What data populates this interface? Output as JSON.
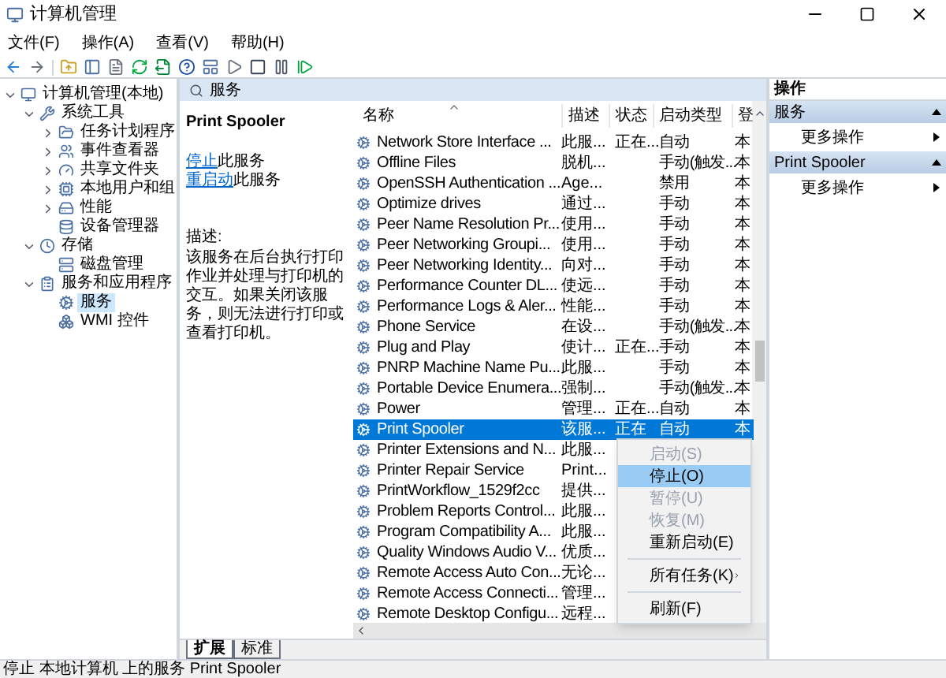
{
  "window": {
    "title": "计算机管理"
  },
  "menu": [
    "文件(F)",
    "操作(A)",
    "查看(V)",
    "帮助(H)"
  ],
  "tree": [
    {
      "label": "计算机管理(本地)",
      "selected": false,
      "expanded": true,
      "children": [
        {
          "label": "系统工具",
          "selected": false,
          "expanded": true,
          "children": [
            {
              "label": "任务计划程序",
              "selected": false,
              "expanded": false
            },
            {
              "label": "事件查看器",
              "selected": false,
              "expanded": false
            },
            {
              "label": "共享文件夹",
              "selected": false,
              "expanded": false
            },
            {
              "label": "本地用户和组",
              "selected": false,
              "expanded": false
            },
            {
              "label": "性能",
              "selected": false,
              "expanded": false
            },
            {
              "label": "设备管理器",
              "selected": false
            }
          ]
        },
        {
          "label": "存储",
          "selected": false,
          "expanded": true,
          "children": [
            {
              "label": "磁盘管理",
              "selected": false
            }
          ]
        },
        {
          "label": "服务和应用程序",
          "selected": false,
          "expanded": true,
          "children": [
            {
              "label": "服务",
              "selected": true
            },
            {
              "label": "WMI 控件",
              "selected": false
            }
          ]
        }
      ]
    }
  ],
  "pane_header": "服务",
  "detail": {
    "title": "Print Spooler",
    "actions": [
      {
        "link": "停止",
        "rest": "此服务"
      },
      {
        "link": "重启动",
        "rest": "此服务"
      }
    ],
    "description_label": "描述:",
    "description": "该服务在后台执行打印作业并处理与打印机的交互。如果关闭该服务，则无法进行打印或查看打印机。"
  },
  "table": {
    "columns": [
      "名称",
      "描述",
      "状态",
      "启动类型",
      "登"
    ],
    "rows": [
      {
        "name": "Network Store Interface ...",
        "desc": "此服...",
        "status": "正在...",
        "startup": "自动",
        "column_5": "本",
        "selected": false
      },
      {
        "name": "Offline Files",
        "desc": "脱机...",
        "startup": "手动(触发...",
        "column_5": "本",
        "selected": false
      },
      {
        "name": "OpenSSH Authentication ...",
        "desc": "Age...",
        "startup": "禁用",
        "column_5": "本",
        "selected": false
      },
      {
        "name": "Optimize drives",
        "desc": "通过...",
        "startup": "手动",
        "column_5": "本",
        "selected": false
      },
      {
        "name": "Peer Name Resolution Pr...",
        "desc": "使用...",
        "startup": "手动",
        "column_5": "本",
        "selected": false
      },
      {
        "name": "Peer Networking Groupi...",
        "desc": "使用...",
        "startup": "手动",
        "column_5": "本",
        "selected": false
      },
      {
        "name": "Peer Networking Identity...",
        "desc": "向对...",
        "startup": "手动",
        "column_5": "本",
        "selected": false
      },
      {
        "name": "Performance Counter DL...",
        "desc": "使远...",
        "startup": "手动",
        "column_5": "本",
        "selected": false
      },
      {
        "name": "Performance Logs & Aler...",
        "desc": "性能...",
        "startup": "手动",
        "column_5": "本",
        "selected": false
      },
      {
        "name": "Phone Service",
        "desc": "在设...",
        "startup": "手动(触发...",
        "column_5": "本",
        "selected": false
      },
      {
        "name": "Plug and Play",
        "desc": "使计...",
        "status": "正在...",
        "startup": "手动",
        "column_5": "本",
        "selected": false
      },
      {
        "name": "PNRP Machine Name Pu...",
        "desc": "此服...",
        "startup": "手动",
        "column_5": "本",
        "selected": false
      },
      {
        "name": "Portable Device Enumera...",
        "desc": "强制...",
        "startup": "手动(触发...",
        "column_5": "本",
        "selected": false
      },
      {
        "name": "Power",
        "desc": "管理...",
        "status": "正在...",
        "startup": "自动",
        "column_5": "本",
        "selected": false
      },
      {
        "name": "Print Spooler",
        "desc": "该服...",
        "status": "正在",
        "startup": "自动",
        "column_5": "本",
        "selected": true
      },
      {
        "name": "Printer Extensions and N...",
        "desc": "此服...",
        "selected": false
      },
      {
        "name": "Printer Repair Service",
        "desc": "Print...",
        "selected": false
      },
      {
        "name": "PrintWorkflow_1529f2cc",
        "desc": "提供...",
        "selected": false
      },
      {
        "name": "Problem Reports Control...",
        "desc": "此服...",
        "selected": false
      },
      {
        "name": "Program Compatibility A...",
        "desc": "此服...",
        "selected": false
      },
      {
        "name": "Quality Windows Audio V...",
        "desc": "优质...",
        "selected": false
      },
      {
        "name": "Remote Access Auto Con...",
        "desc": "无论...",
        "selected": false
      },
      {
        "name": "Remote Access Connecti...",
        "desc": "管理...",
        "selected": false
      },
      {
        "name": "Remote Desktop Configu...",
        "desc": "远程...",
        "selected": false
      }
    ]
  },
  "context_menu": [
    {
      "kind": "item",
      "label": "启动(S)",
      "disabled": true,
      "selected": false
    },
    {
      "kind": "item",
      "label": "停止(O)",
      "disabled": false,
      "selected": true
    },
    {
      "kind": "item",
      "label": "暂停(U)",
      "disabled": true,
      "selected": false
    },
    {
      "kind": "item",
      "label": "恢复(M)",
      "disabled": true,
      "selected": false
    },
    {
      "kind": "item",
      "label": "重新启动(E)",
      "disabled": false,
      "selected": false
    },
    {
      "kind": "separator"
    },
    {
      "kind": "submenu",
      "label": "所有任务(K)",
      "disabled": false,
      "selected": false
    },
    {
      "kind": "separator"
    },
    {
      "kind": "item",
      "label": "刷新(F)",
      "disabled": false,
      "selected": false
    }
  ],
  "bottom_tabs": [
    {
      "label": "扩展",
      "selected": true
    },
    {
      "label": "标准",
      "selected": false
    }
  ],
  "actions_pane": {
    "title": "操作",
    "sections": [
      {
        "title": "服务",
        "expanded": true,
        "items": [
          "更多操作"
        ]
      },
      {
        "title": "Print Spooler",
        "expanded": true,
        "items": [
          "更多操作"
        ]
      }
    ]
  },
  "status_bar": "停止 本地计算机 上的服务 Print Spooler"
}
